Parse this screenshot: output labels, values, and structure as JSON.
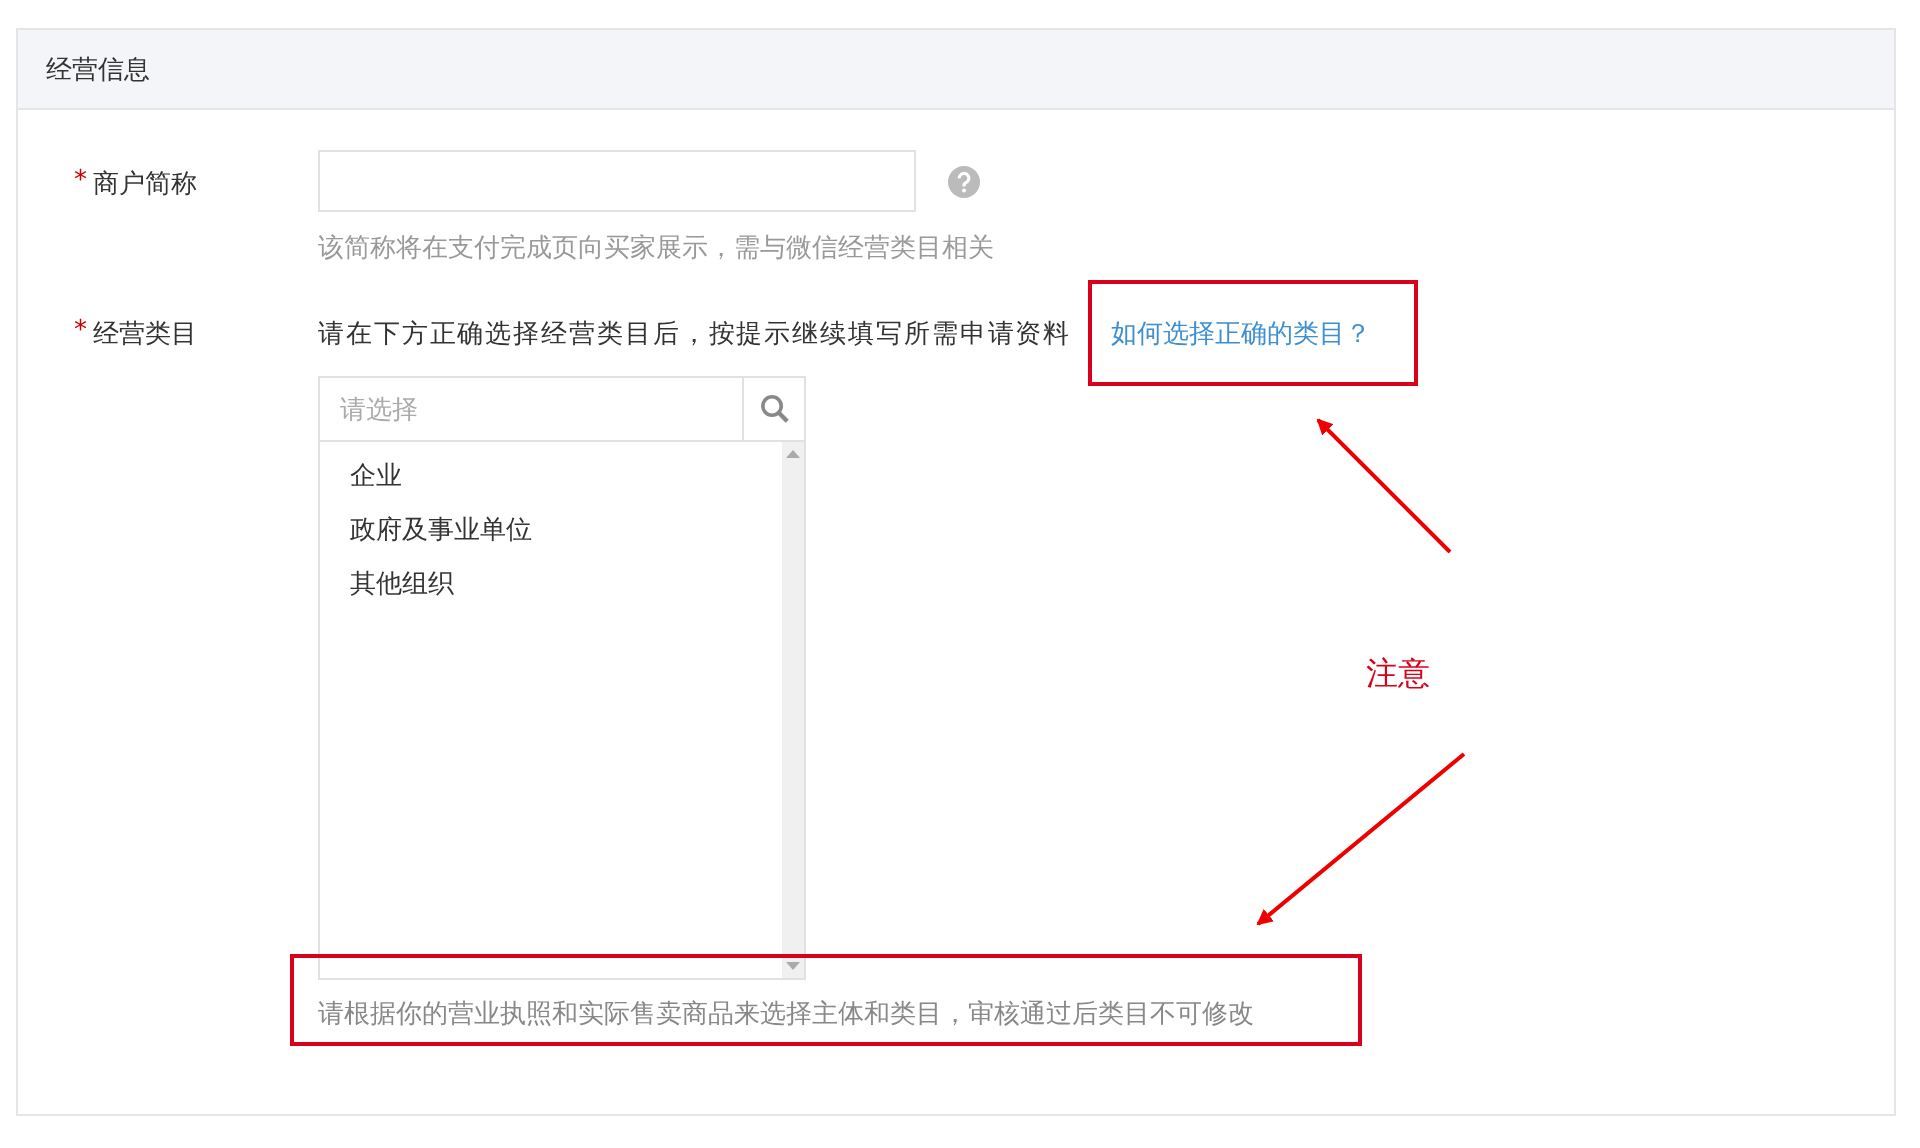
{
  "section_title": "经营信息",
  "merchant_name": {
    "marker": "*",
    "label": "商户简称",
    "hint": "该简称将在支付完成页向买家展示，需与微信经营类目相关"
  },
  "category": {
    "marker": "*",
    "label": "经营类目",
    "instruction": "请在下方正确选择经营类目后，按提示继续填写所需申请资料",
    "help_link": "如何选择正确的类目？",
    "search": {
      "placeholder": "请选择"
    },
    "options": [
      {
        "label": "企业",
        "selected": false
      },
      {
        "label": "政府及事业单位",
        "selected": false
      },
      {
        "label": "其他组织",
        "selected": false
      }
    ],
    "note": "请根据你的营业执照和实际售卖商品来选择主体和类目，审核通过后类目不可修改"
  },
  "annotation": {
    "label": "注意"
  }
}
